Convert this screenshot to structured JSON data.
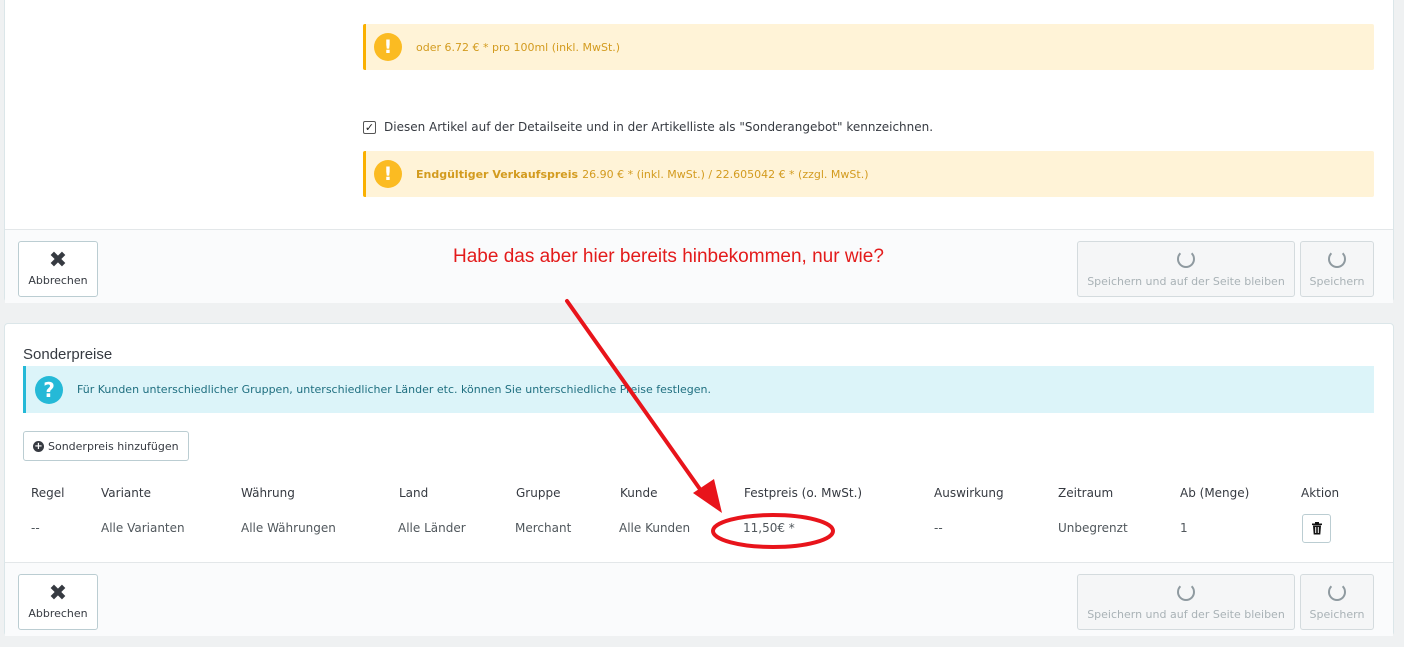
{
  "top_panel": {
    "unit_price_alert": "oder 6.72 € * pro 100ml (inkl. MwSt.)",
    "special_offer_checkbox": {
      "checked": true,
      "label": "Diesen Artikel auf der Detailseite und in der Artikelliste als \"Sonderangebot\" kennzeichnen."
    },
    "final_price_alert": {
      "label": "Endgültiger Verkaufspreis",
      "text": "26.90 € * (inkl. MwSt.) / 22.605042 € * (zzgl. MwSt.)"
    },
    "footer": {
      "cancel_label": "Abbrechen",
      "save_stay_label": "Speichern und auf der Seite bleiben",
      "save_label": "Speichern"
    }
  },
  "annotation": {
    "text": "Habe das aber hier bereits hinbekommen, nur wie?",
    "color": "#e31b1b"
  },
  "special_prices": {
    "title": "Sonderpreise",
    "info_text": "Für Kunden unterschiedlicher Gruppen, unterschiedlicher Länder etc. können Sie unterschiedliche Preise festlegen.",
    "add_button_label": "Sonderpreis hinzufügen",
    "columns": [
      "Regel",
      "Variante",
      "Währung",
      "Land",
      "Gruppe",
      "Kunde",
      "Festpreis (o. MwSt.)",
      "Auswirkung",
      "Zeitraum",
      "Ab (Menge)",
      "Aktion"
    ],
    "rows": [
      [
        "--",
        "Alle Varianten",
        "Alle Währungen",
        "Alle Länder",
        "Merchant",
        "Alle Kunden",
        "11,50€ *",
        "--",
        "Unbegrenzt",
        "1"
      ]
    ],
    "footer": {
      "cancel_label": "Abbrechen",
      "save_stay_label": "Speichern und auf der Seite bleiben",
      "save_label": "Speichern"
    }
  },
  "colors": {
    "warning_bg": "#fff3d7",
    "warning_accent": "#fbbb22",
    "info_bg": "#dcf4f9",
    "info_accent": "#25b9d7"
  }
}
